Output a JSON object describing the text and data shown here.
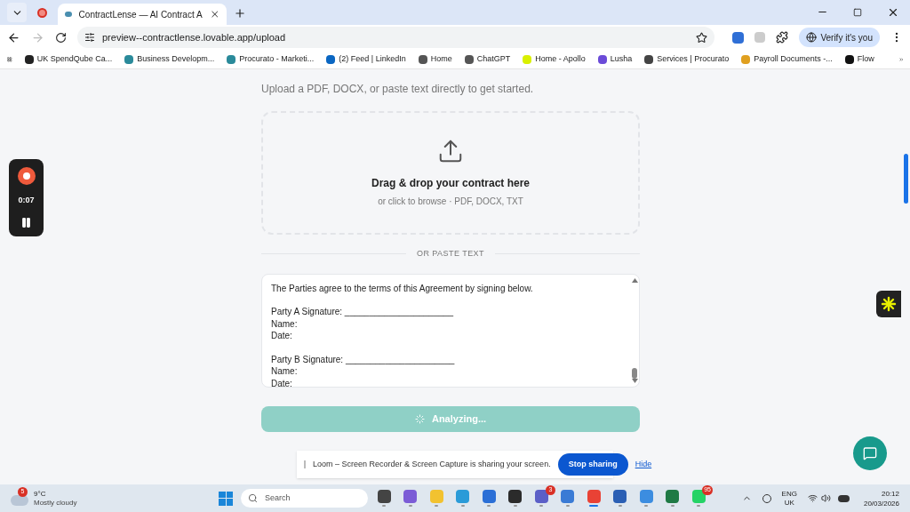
{
  "browser": {
    "tabs": [
      {
        "title": "ContractLense — AI Contract A",
        "selected": true
      }
    ],
    "address": "preview--contractlense.lovable.app/upload",
    "verify_button": "Verify it's you",
    "bookmarks": [
      "UK SpendQube Ca...",
      "Business Developm...",
      "Procurato - Marketi...",
      "(2) Feed | LinkedIn",
      "Home",
      "ChatGPT",
      "Home - Apollo",
      "Lusha",
      "Services | Procurato",
      "Payroll Documents -...",
      "Flow"
    ]
  },
  "page": {
    "subtitle": "Upload a PDF, DOCX, or paste text directly to get started.",
    "dropzone": {
      "title": "Drag & drop your contract here",
      "hint": "or click to browse · PDF, DOCX, TXT"
    },
    "divider_label": "OR PASTE TEXT",
    "contract_text": "The Parties agree to the terms of this Agreement by signing below.\n\nParty A Signature: ______________________\nName:\nDate:\n\nParty B Signature: ______________________\nName:\nDate:",
    "analyze_button": {
      "label": "Analyzing...",
      "loading": true
    }
  },
  "recorder": {
    "time": "0:07"
  },
  "share_bar": {
    "message": "Loom – Screen Recorder & Screen Capture is sharing your screen.",
    "stop_button": "Stop sharing",
    "hide_link": "Hide"
  },
  "taskbar": {
    "weather": {
      "temperature": "9°C",
      "condition": "Mostly cloudy",
      "badge": "5"
    },
    "search_placeholder": "Search",
    "apps": [
      {
        "active": false
      },
      {
        "active": false
      },
      {
        "active": false
      },
      {
        "active": false
      },
      {
        "active": false
      },
      {
        "active": false
      },
      {
        "active": false,
        "badge": "3"
      },
      {
        "active": false
      },
      {
        "active": true
      },
      {
        "active": false
      },
      {
        "active": false
      },
      {
        "active": false
      },
      {
        "active": false,
        "badge": "95"
      }
    ],
    "language": "ENG",
    "region": "UK",
    "time": "20:12",
    "date": "20/03/2026"
  }
}
